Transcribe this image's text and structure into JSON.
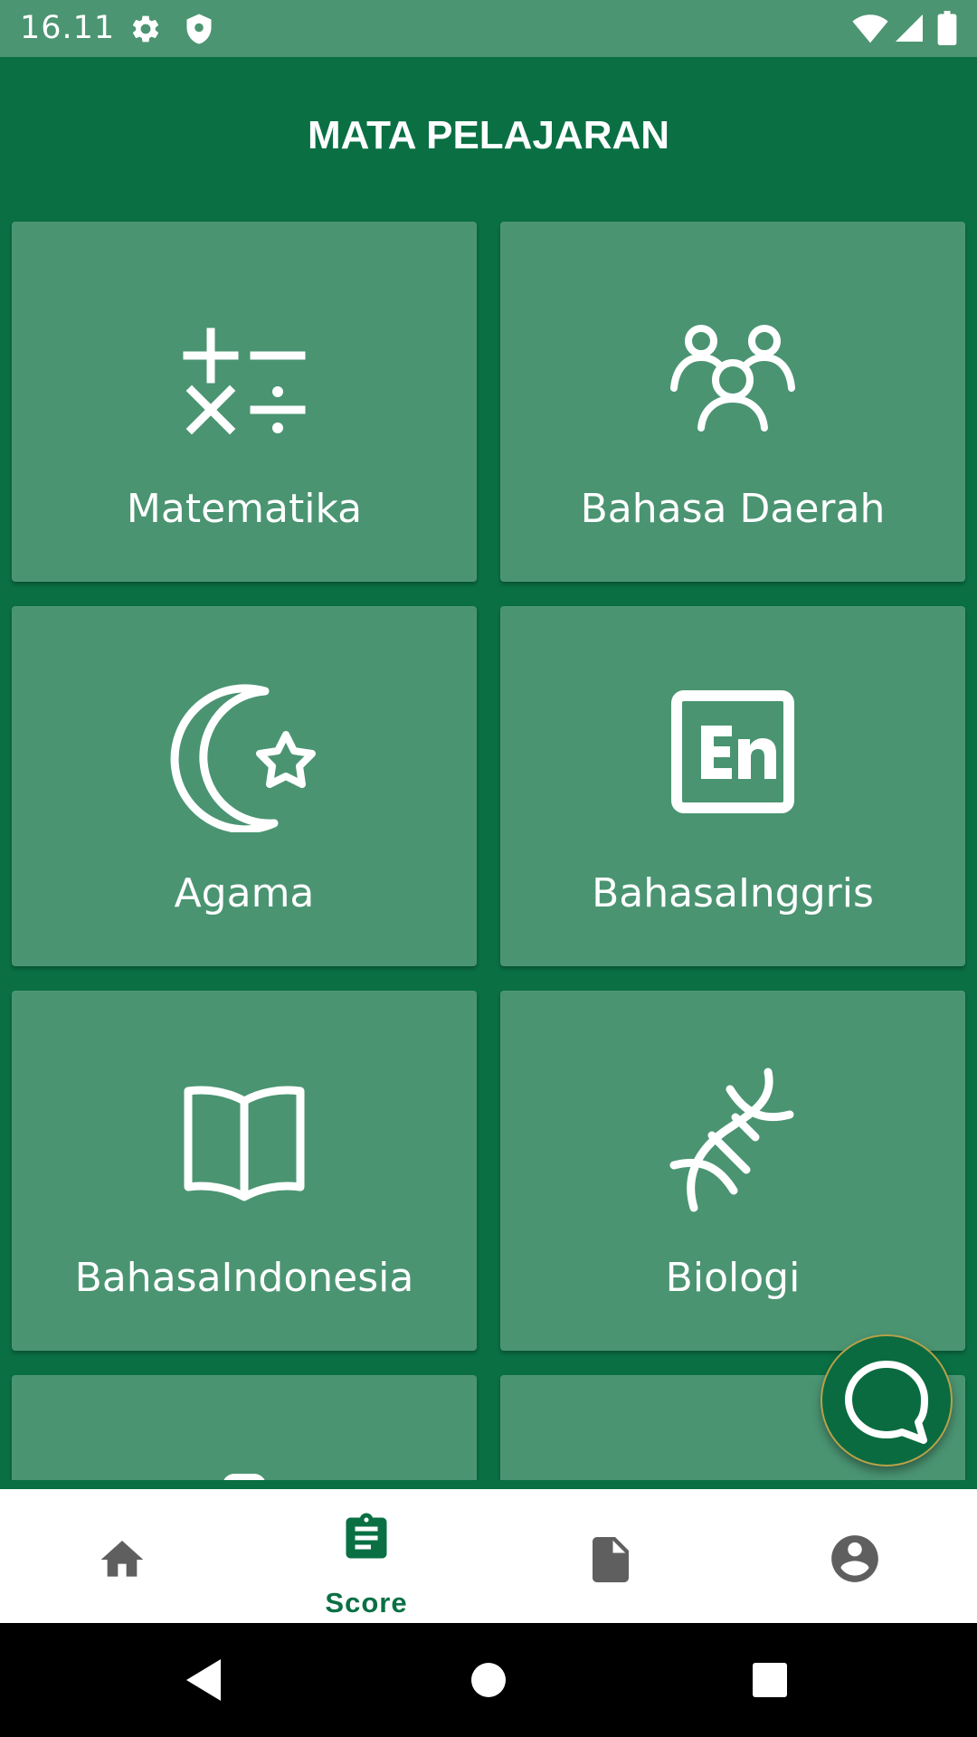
{
  "status_bar": {
    "time": "16.11",
    "icons": [
      "settings-icon",
      "shield-icon",
      "wifi-icon",
      "signal-icon",
      "battery-icon"
    ]
  },
  "header": {
    "title": "MATA PELAJARAN"
  },
  "subjects": [
    {
      "label": "Matematika",
      "icon": "math-operators-icon"
    },
    {
      "label": "Bahasa Daerah",
      "icon": "people-group-icon"
    },
    {
      "label": "Agama",
      "icon": "crescent-star-icon"
    },
    {
      "label": "BahasaInggris",
      "icon": "english-en-icon"
    },
    {
      "label": "BahasaIndonesia",
      "icon": "open-book-icon"
    },
    {
      "label": "Biologi",
      "icon": "dna-icon"
    },
    {
      "label": "",
      "icon": "flask-icon"
    },
    {
      "label": "",
      "icon": "atom-icon"
    }
  ],
  "bottom_nav": {
    "items": [
      {
        "label": "",
        "icon": "home-icon"
      },
      {
        "label": "Score",
        "icon": "clipboard-icon",
        "active": true
      },
      {
        "label": "",
        "icon": "document-icon"
      },
      {
        "label": "",
        "icon": "account-icon"
      }
    ]
  },
  "colors": {
    "primary": "#0a7044",
    "card": "#4a9472",
    "status_bar": "#4c9572",
    "nav_inactive": "#5f5f5f"
  }
}
